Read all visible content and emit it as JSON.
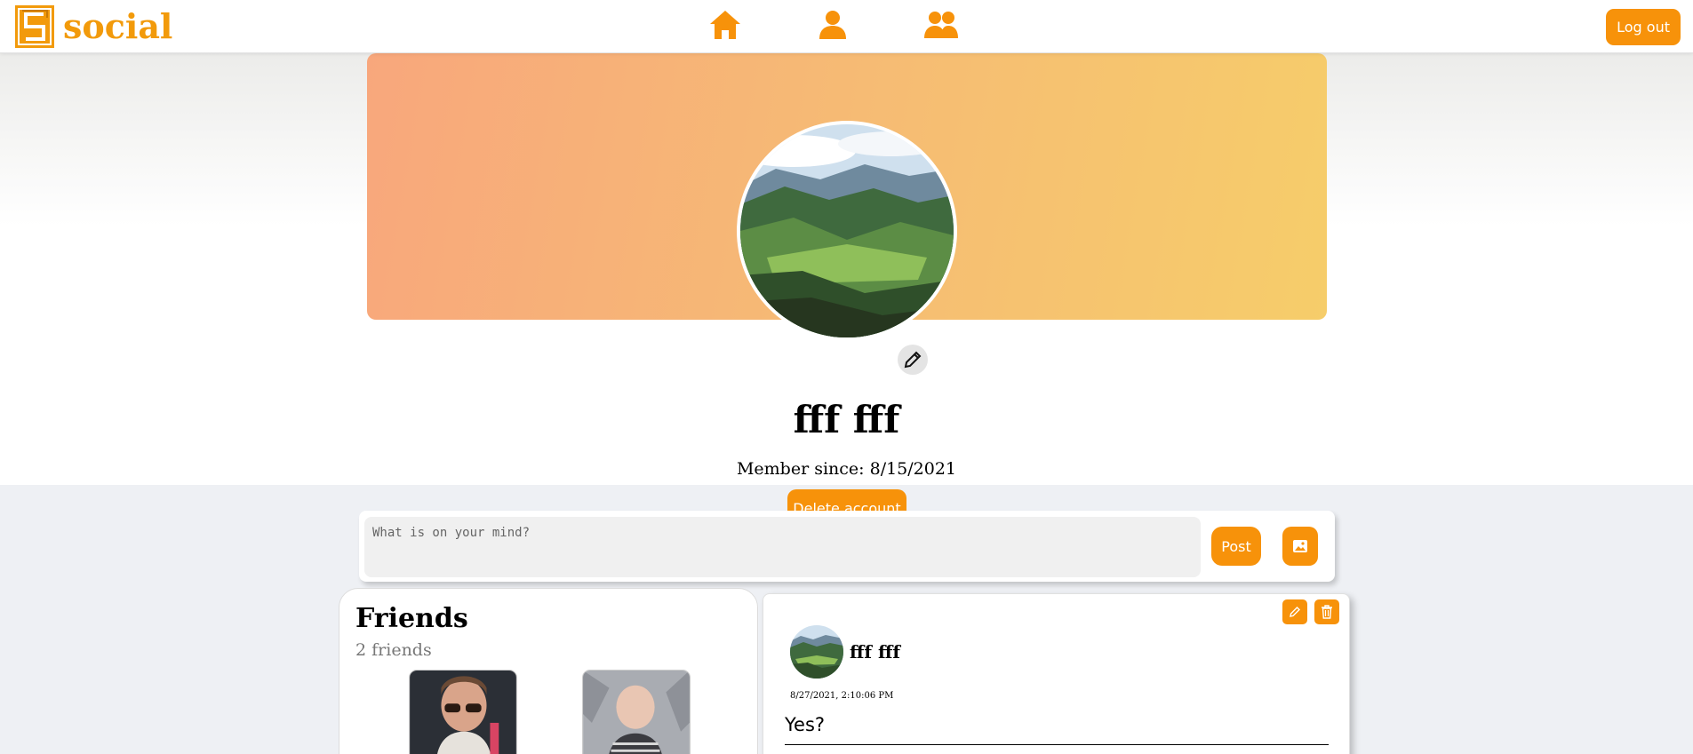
{
  "app": {
    "brand": "social",
    "logout_label": "Log out"
  },
  "nav": {
    "items": [
      {
        "icon": "home-icon"
      },
      {
        "icon": "user-icon"
      },
      {
        "icon": "users-icon"
      }
    ]
  },
  "colors": {
    "accent": "#f7920a",
    "brand": "#f29a0b",
    "cover_start": "#f8a77c",
    "cover_end": "#f6cd6a"
  },
  "profile": {
    "name": "fff fff",
    "member_since": "Member since: 8/15/2021",
    "delete_label": "Delete account"
  },
  "composer": {
    "placeholder": "What is on your mind?",
    "post_label": "Post"
  },
  "friends": {
    "title": "Friends",
    "count": "2 friends"
  },
  "post": {
    "author": "fff fff",
    "timestamp": "8/27/2021, 2:10:06 PM",
    "text": "Yes?"
  }
}
